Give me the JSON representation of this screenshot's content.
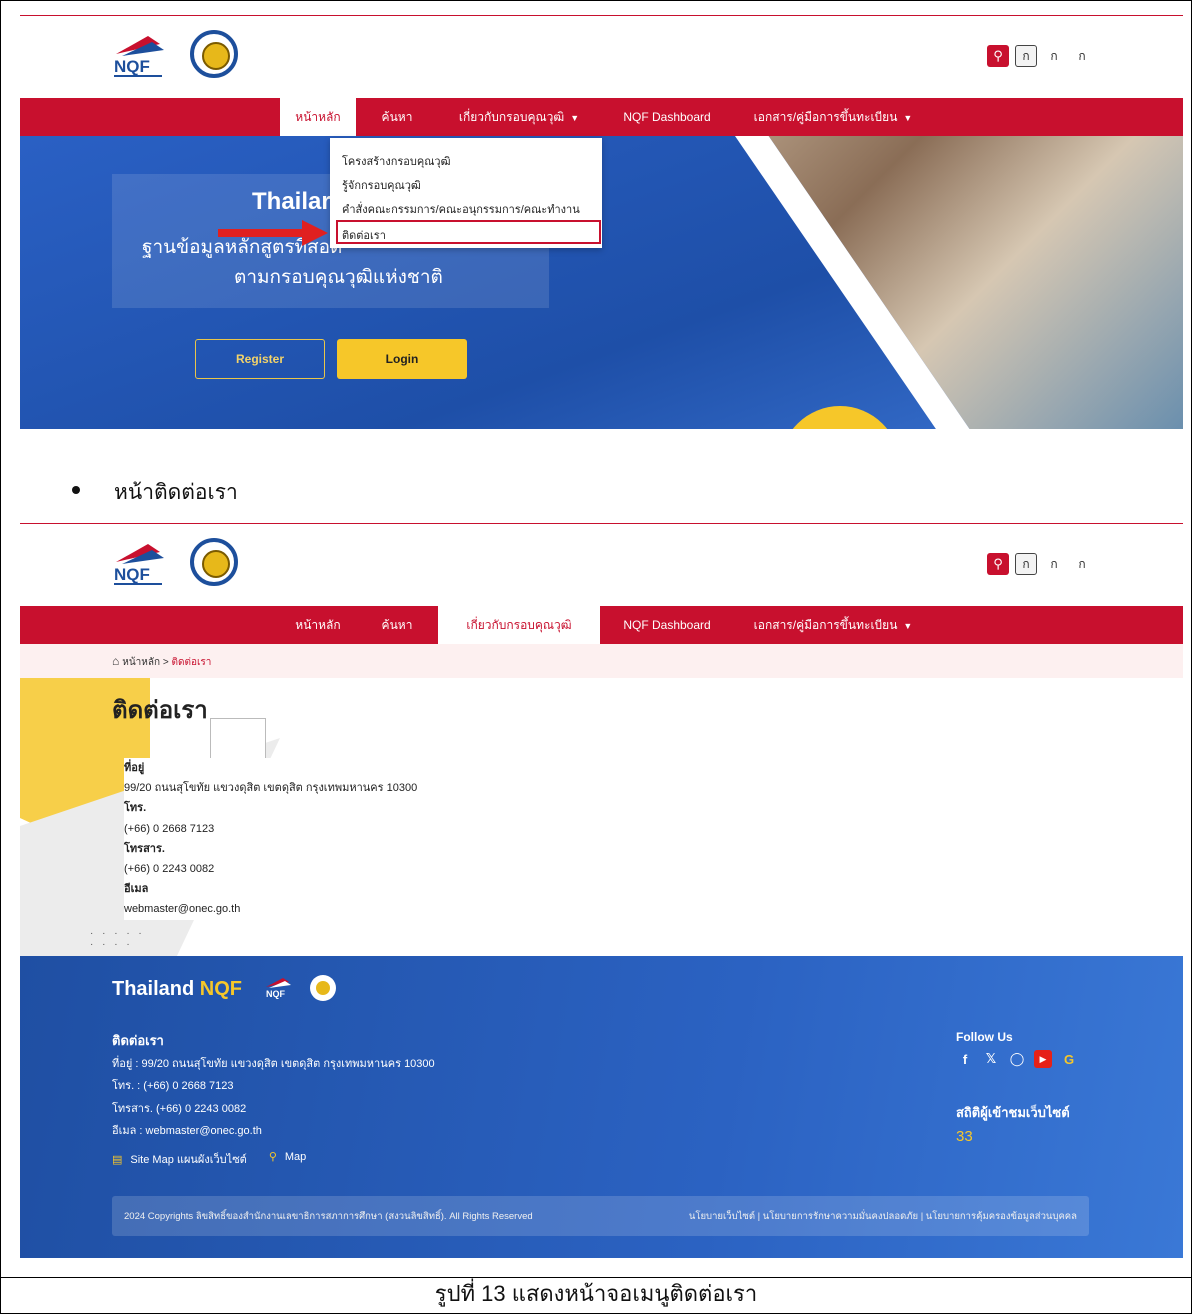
{
  "site": {
    "search_icon": "search-icon",
    "font_sizes": [
      "ก",
      "ก",
      "ก"
    ],
    "nav": {
      "home": "หน้าหลัก",
      "search": "ค้นหา",
      "about": "เกี่ยวกับกรอบคุณวุฒิ",
      "dashboard": "NQF Dashboard",
      "docs": "เอกสาร/คู่มือการขึ้นทะเบียน"
    }
  },
  "shot1": {
    "hero_title": "Thailar",
    "hero_sub1": "ฐานข้อมูลหลักสูตรที่สอด",
    "hero_sub2": "ตามกรอบคุณวุฒิแห่งชาติ",
    "register": "Register",
    "login": "Login",
    "dropdown": [
      "โครงสร้างกรอบคุณวุฒิ",
      "รู้จักกรอบคุณวุฒิ",
      "คำสั่งคณะกรรมการ/คณะอนุกรรมการ/คณะทำงาน",
      "ติดต่อเรา"
    ]
  },
  "bullet_text": "หน้าติดต่อเรา",
  "shot2": {
    "breadcrumb_home": "หน้าหลัก",
    "breadcrumb_sep": ">",
    "breadcrumb_current": "ติดต่อเรา",
    "page_title": "ติดต่อเรา",
    "address_label": "ที่อยู่",
    "address": "99/20 ถนนสุโขทัย แขวงดุสิต เขตดุสิต กรุงเทพมหานคร 10300",
    "tel_label": "โทร.",
    "tel": "(+66) 0 2668 7123",
    "fax_label": "โทรสาร.",
    "fax": "(+66) 0 2243 0082",
    "email_label": "อีเมล",
    "email": "webmaster@onec.go.th"
  },
  "footer": {
    "brand_a": "Thailand ",
    "brand_b": "NQF",
    "contact_heading": "ติดต่อเรา",
    "address_line": "ที่อยู่ : 99/20 ถนนสุโขทัย แขวงดุสิต เขตดุสิต กรุงเทพมหานคร 10300",
    "tel_line": "โทร. : (+66) 0 2668 7123",
    "fax_line": "โทรสาร. (+66) 0 2243 0082",
    "email_line": "อีเมล : webmaster@onec.go.th",
    "sitemap": "Site Map แผนผังเว็บไซต์",
    "map": "Map",
    "follow_us": "Follow Us",
    "stats_heading": "สถิติผู้เข้าชมเว็บไซต์",
    "stats_value": "33",
    "copyright": "2024 Copyrights ลิขสิทธิ์ของสำนักงานเลขาธิการสภาการศึกษา (สงวนลิขสิทธิ์). All Rights Reserved",
    "policies": "นโยบายเว็บไซต์ | นโยบายการรักษาความมั่นคงปลอดภัย | นโยบายการคุ้มครองข้อมูลส่วนบุคคล"
  },
  "caption": "รูปที่ 13 แสดงหน้าจอเมนูติดต่อเรา"
}
